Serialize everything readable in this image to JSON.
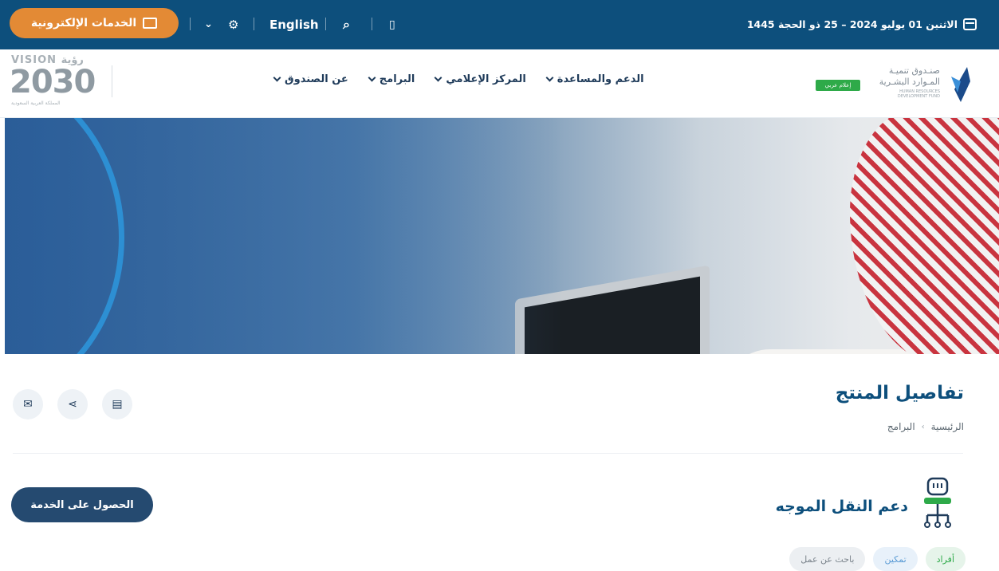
{
  "topbar": {
    "eservices_label": "الخدمات الإلكترونية",
    "language_label": "English",
    "date_text": "الاثنين 01 يوليو 2024  –  25 ذو الحجة 1445"
  },
  "vision": {
    "line1": "VISION رؤية",
    "line2": "2030",
    "line3": "المملكة العربية السعودية"
  },
  "nav": {
    "items": [
      {
        "label": "عن الصندوق"
      },
      {
        "label": "البرامج"
      },
      {
        "label": "المركز الإعلامي"
      },
      {
        "label": "الدعم والمساعدة"
      }
    ]
  },
  "brand": {
    "name_line1": "صنـدوق تنميـة",
    "name_line2": "المـوارد البشـرية",
    "name_en": "HUMAN RESOURCES DEVELOPMENT FUND",
    "badge": "إعلام عربي"
  },
  "page": {
    "title": "تفاصيل المنتج",
    "breadcrumb": [
      "الرئيسية",
      "البرامج"
    ],
    "breadcrumb_sep": "›"
  },
  "service": {
    "title": "دعم النقل الموجه",
    "cta_label": "الحصول على الخدمة",
    "tags": [
      "أفراد",
      "تمكين",
      "باحث عن عمل"
    ]
  },
  "colors": {
    "topbar": "#0d4f7c",
    "accent": "#e38a35",
    "cta": "#254a70"
  }
}
